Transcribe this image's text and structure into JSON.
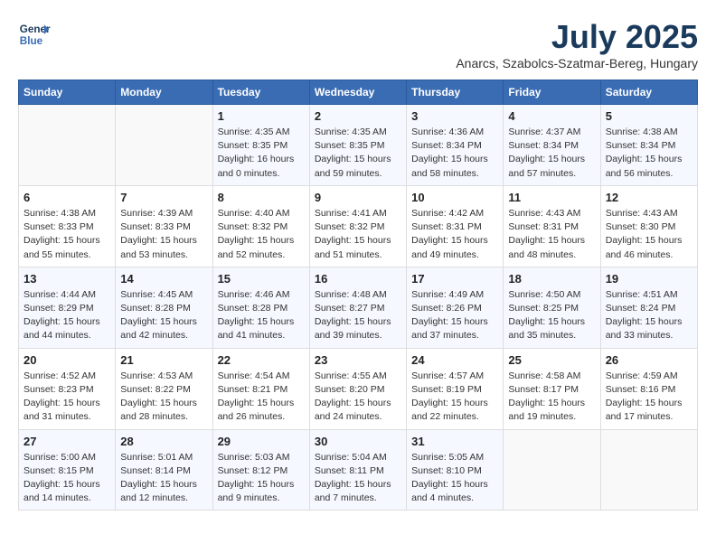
{
  "header": {
    "logo_line1": "General",
    "logo_line2": "Blue",
    "month": "July 2025",
    "location": "Anarcs, Szabolcs-Szatmar-Bereg, Hungary"
  },
  "weekdays": [
    "Sunday",
    "Monday",
    "Tuesday",
    "Wednesday",
    "Thursday",
    "Friday",
    "Saturday"
  ],
  "weeks": [
    [
      {
        "day": "",
        "detail": ""
      },
      {
        "day": "",
        "detail": ""
      },
      {
        "day": "1",
        "detail": "Sunrise: 4:35 AM\nSunset: 8:35 PM\nDaylight: 16 hours\nand 0 minutes."
      },
      {
        "day": "2",
        "detail": "Sunrise: 4:35 AM\nSunset: 8:35 PM\nDaylight: 15 hours\nand 59 minutes."
      },
      {
        "day": "3",
        "detail": "Sunrise: 4:36 AM\nSunset: 8:34 PM\nDaylight: 15 hours\nand 58 minutes."
      },
      {
        "day": "4",
        "detail": "Sunrise: 4:37 AM\nSunset: 8:34 PM\nDaylight: 15 hours\nand 57 minutes."
      },
      {
        "day": "5",
        "detail": "Sunrise: 4:38 AM\nSunset: 8:34 PM\nDaylight: 15 hours\nand 56 minutes."
      }
    ],
    [
      {
        "day": "6",
        "detail": "Sunrise: 4:38 AM\nSunset: 8:33 PM\nDaylight: 15 hours\nand 55 minutes."
      },
      {
        "day": "7",
        "detail": "Sunrise: 4:39 AM\nSunset: 8:33 PM\nDaylight: 15 hours\nand 53 minutes."
      },
      {
        "day": "8",
        "detail": "Sunrise: 4:40 AM\nSunset: 8:32 PM\nDaylight: 15 hours\nand 52 minutes."
      },
      {
        "day": "9",
        "detail": "Sunrise: 4:41 AM\nSunset: 8:32 PM\nDaylight: 15 hours\nand 51 minutes."
      },
      {
        "day": "10",
        "detail": "Sunrise: 4:42 AM\nSunset: 8:31 PM\nDaylight: 15 hours\nand 49 minutes."
      },
      {
        "day": "11",
        "detail": "Sunrise: 4:43 AM\nSunset: 8:31 PM\nDaylight: 15 hours\nand 48 minutes."
      },
      {
        "day": "12",
        "detail": "Sunrise: 4:43 AM\nSunset: 8:30 PM\nDaylight: 15 hours\nand 46 minutes."
      }
    ],
    [
      {
        "day": "13",
        "detail": "Sunrise: 4:44 AM\nSunset: 8:29 PM\nDaylight: 15 hours\nand 44 minutes."
      },
      {
        "day": "14",
        "detail": "Sunrise: 4:45 AM\nSunset: 8:28 PM\nDaylight: 15 hours\nand 42 minutes."
      },
      {
        "day": "15",
        "detail": "Sunrise: 4:46 AM\nSunset: 8:28 PM\nDaylight: 15 hours\nand 41 minutes."
      },
      {
        "day": "16",
        "detail": "Sunrise: 4:48 AM\nSunset: 8:27 PM\nDaylight: 15 hours\nand 39 minutes."
      },
      {
        "day": "17",
        "detail": "Sunrise: 4:49 AM\nSunset: 8:26 PM\nDaylight: 15 hours\nand 37 minutes."
      },
      {
        "day": "18",
        "detail": "Sunrise: 4:50 AM\nSunset: 8:25 PM\nDaylight: 15 hours\nand 35 minutes."
      },
      {
        "day": "19",
        "detail": "Sunrise: 4:51 AM\nSunset: 8:24 PM\nDaylight: 15 hours\nand 33 minutes."
      }
    ],
    [
      {
        "day": "20",
        "detail": "Sunrise: 4:52 AM\nSunset: 8:23 PM\nDaylight: 15 hours\nand 31 minutes."
      },
      {
        "day": "21",
        "detail": "Sunrise: 4:53 AM\nSunset: 8:22 PM\nDaylight: 15 hours\nand 28 minutes."
      },
      {
        "day": "22",
        "detail": "Sunrise: 4:54 AM\nSunset: 8:21 PM\nDaylight: 15 hours\nand 26 minutes."
      },
      {
        "day": "23",
        "detail": "Sunrise: 4:55 AM\nSunset: 8:20 PM\nDaylight: 15 hours\nand 24 minutes."
      },
      {
        "day": "24",
        "detail": "Sunrise: 4:57 AM\nSunset: 8:19 PM\nDaylight: 15 hours\nand 22 minutes."
      },
      {
        "day": "25",
        "detail": "Sunrise: 4:58 AM\nSunset: 8:17 PM\nDaylight: 15 hours\nand 19 minutes."
      },
      {
        "day": "26",
        "detail": "Sunrise: 4:59 AM\nSunset: 8:16 PM\nDaylight: 15 hours\nand 17 minutes."
      }
    ],
    [
      {
        "day": "27",
        "detail": "Sunrise: 5:00 AM\nSunset: 8:15 PM\nDaylight: 15 hours\nand 14 minutes."
      },
      {
        "day": "28",
        "detail": "Sunrise: 5:01 AM\nSunset: 8:14 PM\nDaylight: 15 hours\nand 12 minutes."
      },
      {
        "day": "29",
        "detail": "Sunrise: 5:03 AM\nSunset: 8:12 PM\nDaylight: 15 hours\nand 9 minutes."
      },
      {
        "day": "30",
        "detail": "Sunrise: 5:04 AM\nSunset: 8:11 PM\nDaylight: 15 hours\nand 7 minutes."
      },
      {
        "day": "31",
        "detail": "Sunrise: 5:05 AM\nSunset: 8:10 PM\nDaylight: 15 hours\nand 4 minutes."
      },
      {
        "day": "",
        "detail": ""
      },
      {
        "day": "",
        "detail": ""
      }
    ]
  ]
}
